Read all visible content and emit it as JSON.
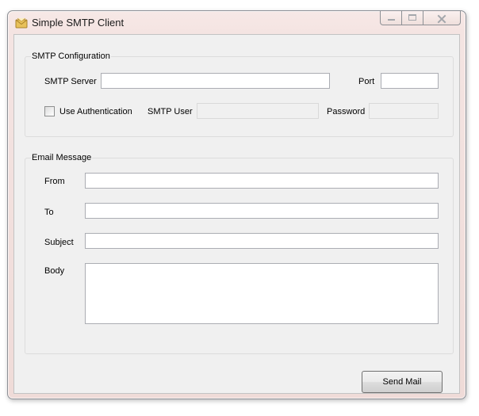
{
  "window": {
    "title": "Simple SMTP Client",
    "icon": "envelope-icon",
    "controls": [
      "minimize-icon",
      "maximize-icon",
      "close-icon"
    ]
  },
  "smtp_configuration": {
    "legend": "SMTP Configuration",
    "server_label": "SMTP Server",
    "server_value": "",
    "port_label": "Port",
    "port_value": "",
    "use_auth_label": "Use Authentication",
    "use_auth_checked": false,
    "user_label": "SMTP User",
    "user_value": "",
    "password_label": "Password",
    "password_value": ""
  },
  "email_message": {
    "legend": "Email Message",
    "from_label": "From",
    "from_value": "",
    "to_label": "To",
    "to_value": "",
    "subject_label": "Subject",
    "subject_value": "",
    "body_label": "Body",
    "body_value": ""
  },
  "actions": {
    "send_label": "Send Mail"
  },
  "colors": {
    "client_background": "#f0f0f0",
    "title_bar": "#f4e4e2",
    "envelope": "#e8c15a"
  }
}
